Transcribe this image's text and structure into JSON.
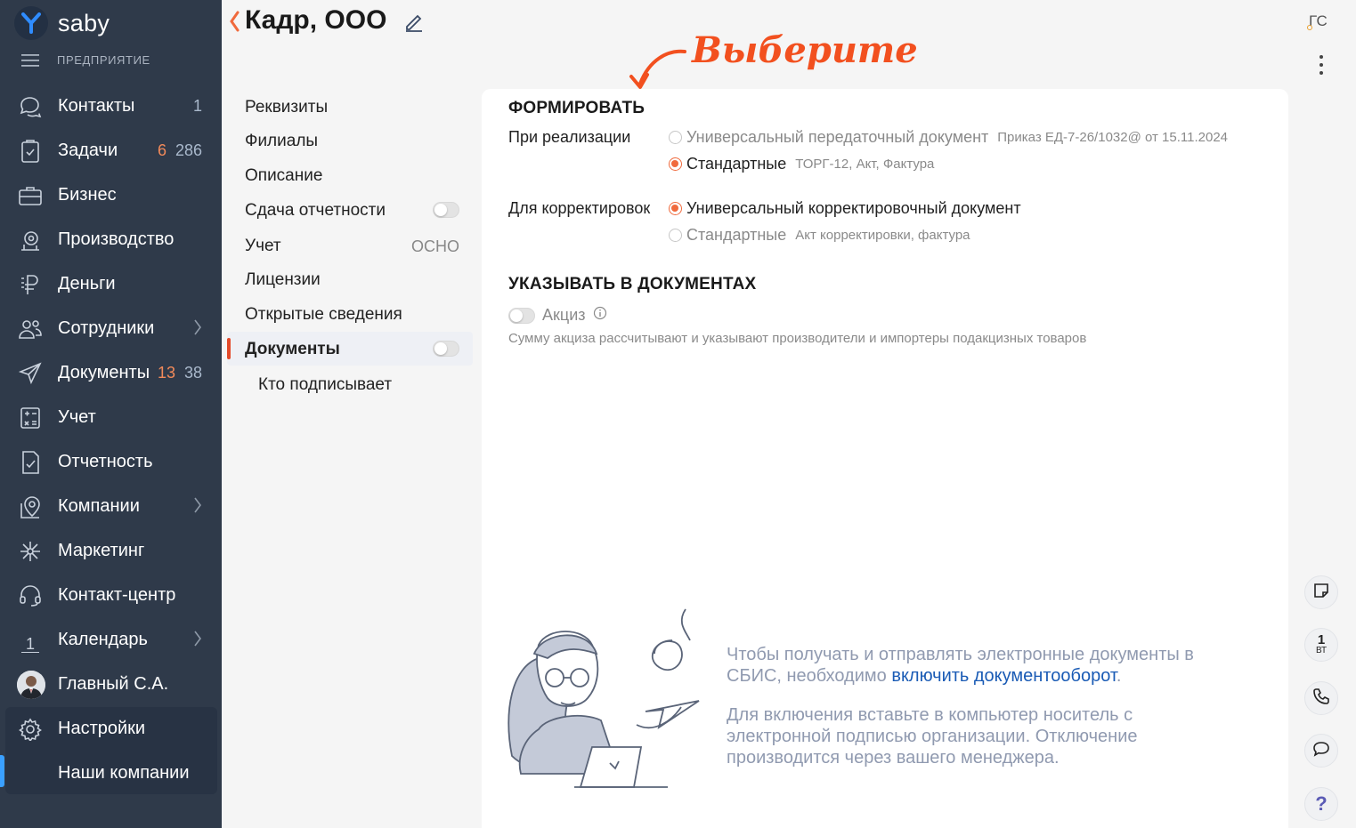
{
  "brand": {
    "name": "saby"
  },
  "org": {
    "label": "ПРЕДПРИЯТИЕ"
  },
  "nav": [
    {
      "label": "Контакты",
      "count_b": "1",
      "icon": "chat-bubbles-icon"
    },
    {
      "label": "Задачи",
      "count_a": "6",
      "count_b": "286",
      "icon": "clipboard-check-icon"
    },
    {
      "label": "Бизнес",
      "icon": "briefcase-icon"
    },
    {
      "label": "Производство",
      "icon": "factory-icon"
    },
    {
      "label": "Деньги",
      "icon": "ruble-icon"
    },
    {
      "label": "Сотрудники",
      "icon": "people-icon",
      "chevron": true
    },
    {
      "label": "Документы",
      "count_a": "13",
      "count_b": "38",
      "icon": "paper-plane-icon"
    },
    {
      "label": "Учет",
      "icon": "calculator-icon"
    },
    {
      "label": "Отчетность",
      "icon": "report-icon"
    },
    {
      "label": "Компании",
      "icon": "map-pin-icon",
      "chevron": true
    },
    {
      "label": "Маркетинг",
      "icon": "sparkle-icon"
    },
    {
      "label": "Контакт-центр",
      "icon": "headset-icon"
    },
    {
      "label": "Календарь",
      "icon": "calendar-icon",
      "cal_num": "1",
      "chevron": true
    },
    {
      "label": "Главный С.А.",
      "icon": "avatar"
    },
    {
      "label": "Настройки",
      "icon": "gear-icon"
    },
    {
      "label": "Наши компании"
    }
  ],
  "header": {
    "title": "Кадр, ООО",
    "user_initials": "ГС"
  },
  "annotation": {
    "text": "Выберите"
  },
  "tabs": {
    "requisites": "Реквизиты",
    "branches": "Филиалы",
    "description": "Описание",
    "reporting": "Сдача отчетности",
    "accounting": "Учет",
    "accounting_value": "ОСНО",
    "licenses": "Лицензии",
    "open_info": "Открытые сведения",
    "documents": "Документы",
    "signers": "Кто подписывает"
  },
  "form": {
    "section_title": "ФОРМИРОВАТЬ",
    "sale_label": "При реализации",
    "sale_upd": "Универсальный передаточный документ",
    "sale_upd_hint": "Приказ ЕД-7-26/1032@ от 15.11.2024",
    "sale_std": "Стандартные",
    "sale_std_hint": "ТОРГ-12, Акт, Фактура",
    "corr_label": "Для корректировок",
    "corr_ukd": "Универсальный корректировочный документ",
    "corr_std": "Стандартные",
    "corr_std_hint": "Акт корректировки, фактура"
  },
  "indicate": {
    "section_title": "УКАЗЫВАТЬ В ДОКУМЕНТАХ",
    "excise_label": "Акциз",
    "excise_note": "Сумму акциза рассчитывают и указывают производители и импортеры подакцизных товаров"
  },
  "promo": {
    "text1_a": "Чтобы получать и отправлять электронные документы в СБИС, необходимо ",
    "text1_link": "включить документооборот",
    "text1_b": ".",
    "text2": "Для включения вставьте в компьютер носитель с электронной подписью организации. Отключение производится через вашего менеджера."
  },
  "rail": {
    "cal_num": "1",
    "cal_day": "ВТ",
    "help": "?"
  },
  "colors": {
    "sidebar": "#2f3a4a",
    "accent": "#f06a3d",
    "link": "#1a5bb5",
    "active_bar": "#3aa0ff"
  }
}
